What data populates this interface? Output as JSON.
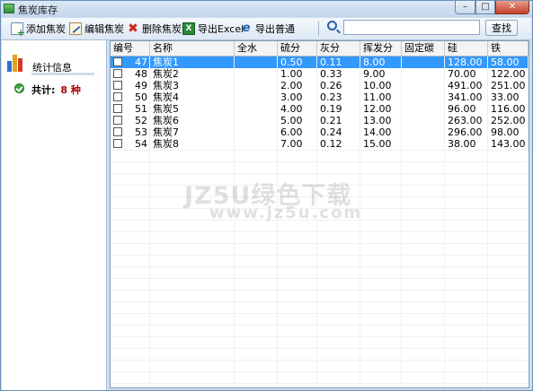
{
  "window": {
    "title": "焦炭库存"
  },
  "title_buttons": {
    "minimize": "–",
    "maximize": "□",
    "close": "✕"
  },
  "toolbar": {
    "add_label": "添加焦炭",
    "edit_label": "编辑焦炭",
    "delete_label": "删除焦炭",
    "export_excel_label": "导出Excel",
    "export_normal_label": "导出普通",
    "search_placeholder": "",
    "search_value": "",
    "find_label": "查找"
  },
  "sidebar": {
    "stat_label": "统计信息",
    "total_label": "共计:",
    "total_value": "8 种"
  },
  "table": {
    "columns": [
      "编号",
      "名称",
      "全水",
      "硫分",
      "灰分",
      "挥发分",
      "固定碳",
      "硅",
      "铁"
    ],
    "rows": [
      {
        "id": "47",
        "name": "焦炭1",
        "water": "",
        "sulfur": "0.50",
        "ash": "0.11",
        "volatile": "8.00",
        "fixed_carbon": "",
        "si": "128.00",
        "fe": "58.00",
        "selected": true
      },
      {
        "id": "48",
        "name": "焦炭2",
        "water": "",
        "sulfur": "1.00",
        "ash": "0.33",
        "volatile": "9.00",
        "fixed_carbon": "",
        "si": "70.00",
        "fe": "122.00",
        "selected": false
      },
      {
        "id": "49",
        "name": "焦炭3",
        "water": "",
        "sulfur": "2.00",
        "ash": "0.26",
        "volatile": "10.00",
        "fixed_carbon": "",
        "si": "491.00",
        "fe": "251.00",
        "selected": false
      },
      {
        "id": "50",
        "name": "焦炭4",
        "water": "",
        "sulfur": "3.00",
        "ash": "0.23",
        "volatile": "11.00",
        "fixed_carbon": "",
        "si": "341.00",
        "fe": "33.00",
        "selected": false
      },
      {
        "id": "51",
        "name": "焦炭5",
        "water": "",
        "sulfur": "4.00",
        "ash": "0.19",
        "volatile": "12.00",
        "fixed_carbon": "",
        "si": "96.00",
        "fe": "116.00",
        "selected": false
      },
      {
        "id": "52",
        "name": "焦炭6",
        "water": "",
        "sulfur": "5.00",
        "ash": "0.21",
        "volatile": "13.00",
        "fixed_carbon": "",
        "si": "263.00",
        "fe": "252.00",
        "selected": false
      },
      {
        "id": "53",
        "name": "焦炭7",
        "water": "",
        "sulfur": "6.00",
        "ash": "0.24",
        "volatile": "14.00",
        "fixed_carbon": "",
        "si": "296.00",
        "fe": "98.00",
        "selected": false
      },
      {
        "id": "54",
        "name": "焦炭8",
        "water": "",
        "sulfur": "7.00",
        "ash": "0.12",
        "volatile": "15.00",
        "fixed_carbon": "",
        "si": "38.00",
        "fe": "143.00",
        "selected": false
      }
    ]
  },
  "watermark": {
    "line1": "JZ5U绿色下载",
    "line2": "www.jz5u.com"
  },
  "colors": {
    "selection": "#3399ff",
    "total_count": "#b00000",
    "window_frame": "#cfdff0"
  }
}
